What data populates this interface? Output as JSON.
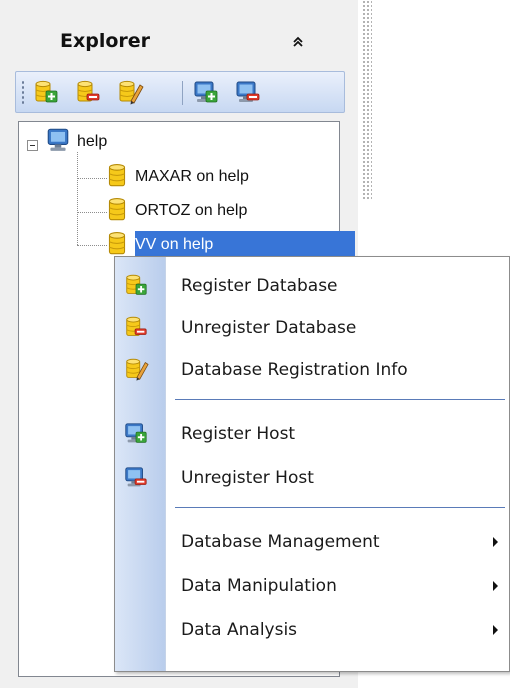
{
  "explorer": {
    "title": "Explorer",
    "collapse_icon": "double-chevron-up-icon"
  },
  "toolbar": {
    "buttons": [
      {
        "icon": "register-database-icon"
      },
      {
        "icon": "unregister-database-icon"
      },
      {
        "icon": "database-registration-info-icon"
      },
      {
        "icon": "register-host-icon"
      },
      {
        "icon": "unregister-host-icon"
      }
    ]
  },
  "tree": {
    "host": {
      "label": "help",
      "icon": "host-computer-icon",
      "expanded": true
    },
    "databases": [
      {
        "label": "MAXAR on help",
        "icon": "database-icon",
        "selected": false
      },
      {
        "label": "ORTOZ on help",
        "icon": "database-icon",
        "selected": false
      },
      {
        "label": "VV on help",
        "icon": "database-icon",
        "selected": true
      }
    ]
  },
  "context_menu": {
    "items": [
      {
        "label": "Register Database",
        "icon": "register-database-icon"
      },
      {
        "label": "Unregister Database",
        "icon": "unregister-database-icon"
      },
      {
        "label": "Database Registration Info",
        "icon": "database-registration-info-icon"
      },
      {
        "label": "Register Host",
        "icon": "register-host-icon"
      },
      {
        "label": "Unregister Host",
        "icon": "unregister-host-icon"
      },
      {
        "label": "Database Management",
        "submenu": true
      },
      {
        "label": "Data Manipulation",
        "submenu": true
      },
      {
        "label": "Data Analysis",
        "submenu": true
      }
    ]
  },
  "colors": {
    "selection": "#3875d7",
    "db_yellow": "#f6c91a",
    "add_green": "#3aa53a",
    "remove_red": "#e03a2a",
    "host_blue": "#3b78c7"
  }
}
